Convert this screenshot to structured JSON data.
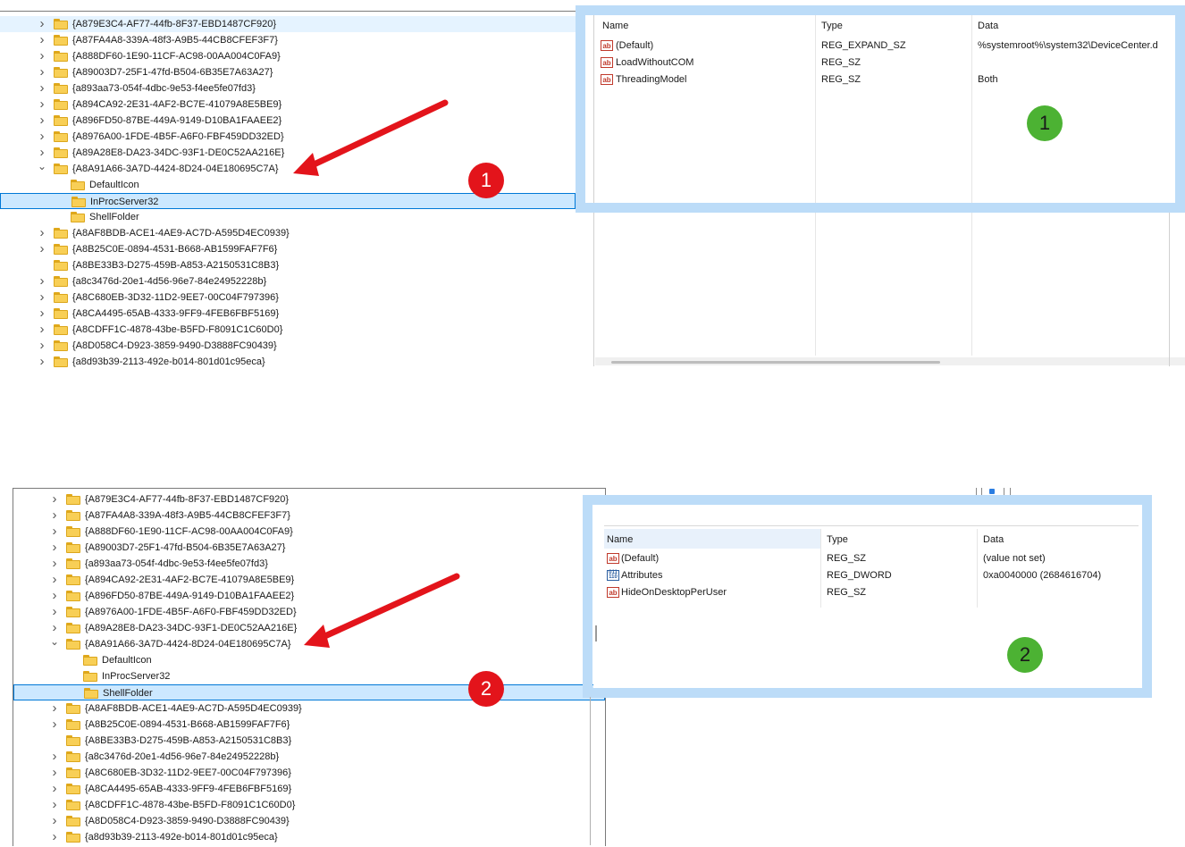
{
  "top": {
    "tree_items": [
      {
        "label": "{A879E3C4-AF77-44fb-8F37-EBD1487CF920}",
        "expander": "›",
        "state": "hover"
      },
      {
        "label": "{A87FA4A8-339A-48f3-A9B5-44CB8CFEF3F7}",
        "expander": "›"
      },
      {
        "label": "{A888DF60-1E90-11CF-AC98-00AA004C0FA9}",
        "expander": "›"
      },
      {
        "label": "{A89003D7-25F1-47fd-B504-6B35E7A63A27}",
        "expander": "›"
      },
      {
        "label": "{a893aa73-054f-4dbc-9e53-f4ee5fe07fd3}",
        "expander": "›"
      },
      {
        "label": "{A894CA92-2E31-4AF2-BC7E-41079A8E5BE9}",
        "expander": "›"
      },
      {
        "label": "{A896FD50-87BE-449A-9149-D10BA1FAAEE2}",
        "expander": "›"
      },
      {
        "label": "{A8976A00-1FDE-4B5F-A6F0-FBF459DD32ED}",
        "expander": "›"
      },
      {
        "label": "{A89A28E8-DA23-34DC-93F1-DE0C52AA216E}",
        "expander": "›"
      },
      {
        "label": "{A8A91A66-3A7D-4424-8D24-04E180695C7A}",
        "expander": "⌄"
      },
      {
        "label": "DefaultIcon",
        "child": true
      },
      {
        "label": "InProcServer32",
        "child": true,
        "state": "selected"
      },
      {
        "label": "ShellFolder",
        "child": true
      },
      {
        "label": "{A8AF8BDB-ACE1-4AE9-AC7D-A595D4EC0939}",
        "expander": "›"
      },
      {
        "label": "{A8B25C0E-0894-4531-B668-AB1599FAF7F6}",
        "expander": "›"
      },
      {
        "label": "{A8BE33B3-D275-459B-A853-A2150531C8B3}"
      },
      {
        "label": "{a8c3476d-20e1-4d56-96e7-84e24952228b}",
        "expander": "›"
      },
      {
        "label": "{A8C680EB-3D32-11D2-9EE7-00C04F797396}",
        "expander": "›"
      },
      {
        "label": "{A8CA4495-65AB-4333-9FF9-4FEB6FBF5169}",
        "expander": "›"
      },
      {
        "label": "{A8CDFF1C-4878-43be-B5FD-F8091C1C60D0}",
        "expander": "›"
      },
      {
        "label": "{A8D058C4-D923-3859-9490-D3888FC90439}",
        "expander": "›"
      },
      {
        "label": "{a8d93b39-2113-492e-b014-801d01c95eca}",
        "expander": "›"
      }
    ],
    "columns": {
      "name": "Name",
      "type": "Type",
      "data": "Data"
    },
    "values": [
      {
        "icon": "string-value-icon",
        "icon_text": "ab",
        "name": "(Default)",
        "type": "REG_EXPAND_SZ",
        "data": "%systemroot%\\system32\\DeviceCenter.d"
      },
      {
        "icon": "string-value-icon",
        "icon_text": "ab",
        "name": "LoadWithoutCOM",
        "type": "REG_SZ",
        "data": ""
      },
      {
        "icon": "string-value-icon",
        "icon_text": "ab",
        "name": "ThreadingModel",
        "type": "REG_SZ",
        "data": "Both"
      }
    ],
    "badge_red": "1",
    "badge_green": "1"
  },
  "bottom": {
    "tree_items": [
      {
        "label": "{A879E3C4-AF77-44fb-8F37-EBD1487CF920}",
        "expander": "›"
      },
      {
        "label": "{A87FA4A8-339A-48f3-A9B5-44CB8CFEF3F7}",
        "expander": "›"
      },
      {
        "label": "{A888DF60-1E90-11CF-AC98-00AA004C0FA9}",
        "expander": "›"
      },
      {
        "label": "{A89003D7-25F1-47fd-B504-6B35E7A63A27}",
        "expander": "›"
      },
      {
        "label": "{a893aa73-054f-4dbc-9e53-f4ee5fe07fd3}",
        "expander": "›"
      },
      {
        "label": "{A894CA92-2E31-4AF2-BC7E-41079A8E5BE9}",
        "expander": "›"
      },
      {
        "label": "{A896FD50-87BE-449A-9149-D10BA1FAAEE2}",
        "expander": "›"
      },
      {
        "label": "{A8976A00-1FDE-4B5F-A6F0-FBF459DD32ED}",
        "expander": "›"
      },
      {
        "label": "{A89A28E8-DA23-34DC-93F1-DE0C52AA216E}",
        "expander": "›"
      },
      {
        "label": "{A8A91A66-3A7D-4424-8D24-04E180695C7A}",
        "expander": "⌄"
      },
      {
        "label": "DefaultIcon",
        "child": true
      },
      {
        "label": "InProcServer32",
        "child": true
      },
      {
        "label": "ShellFolder",
        "child": true,
        "state": "selected"
      },
      {
        "label": "{A8AF8BDB-ACE1-4AE9-AC7D-A595D4EC0939}",
        "expander": "›"
      },
      {
        "label": "{A8B25C0E-0894-4531-B668-AB1599FAF7F6}",
        "expander": "›"
      },
      {
        "label": "{A8BE33B3-D275-459B-A853-A2150531C8B3}"
      },
      {
        "label": "{a8c3476d-20e1-4d56-96e7-84e24952228b}",
        "expander": "›"
      },
      {
        "label": "{A8C680EB-3D32-11D2-9EE7-00C04F797396}",
        "expander": "›"
      },
      {
        "label": "{A8CA4495-65AB-4333-9FF9-4FEB6FBF5169}",
        "expander": "›"
      },
      {
        "label": "{A8CDFF1C-4878-43be-B5FD-F8091C1C60D0}",
        "expander": "›"
      },
      {
        "label": "{A8D058C4-D923-3859-9490-D3888FC90439}",
        "expander": "›"
      },
      {
        "label": "{a8d93b39-2113-492e-b014-801d01c95eca}",
        "expander": "›"
      }
    ],
    "columns": {
      "name": "Name",
      "type": "Type",
      "data": "Data"
    },
    "values": [
      {
        "icon": "string-value-icon",
        "icon_text": "ab",
        "name": "(Default)",
        "type": "REG_SZ",
        "data": "(value not set)"
      },
      {
        "icon": "binary-value-icon",
        "icon_text": "011\n110",
        "name": "Attributes",
        "type": "REG_DWORD",
        "data": "0xa0040000 (2684616704)"
      },
      {
        "icon": "string-value-icon",
        "icon_text": "ab",
        "name": "HideOnDesktopPerUser",
        "type": "REG_SZ",
        "data": ""
      }
    ],
    "badge_red": "2",
    "badge_green": "2"
  },
  "colors": {
    "arrow": "#e3141b",
    "highlight_box": "#bcdcf8",
    "selected_row": "#cce8ff",
    "folder": "#f8cf56",
    "badge_red": "#e3141b",
    "badge_green": "#4cb233"
  }
}
